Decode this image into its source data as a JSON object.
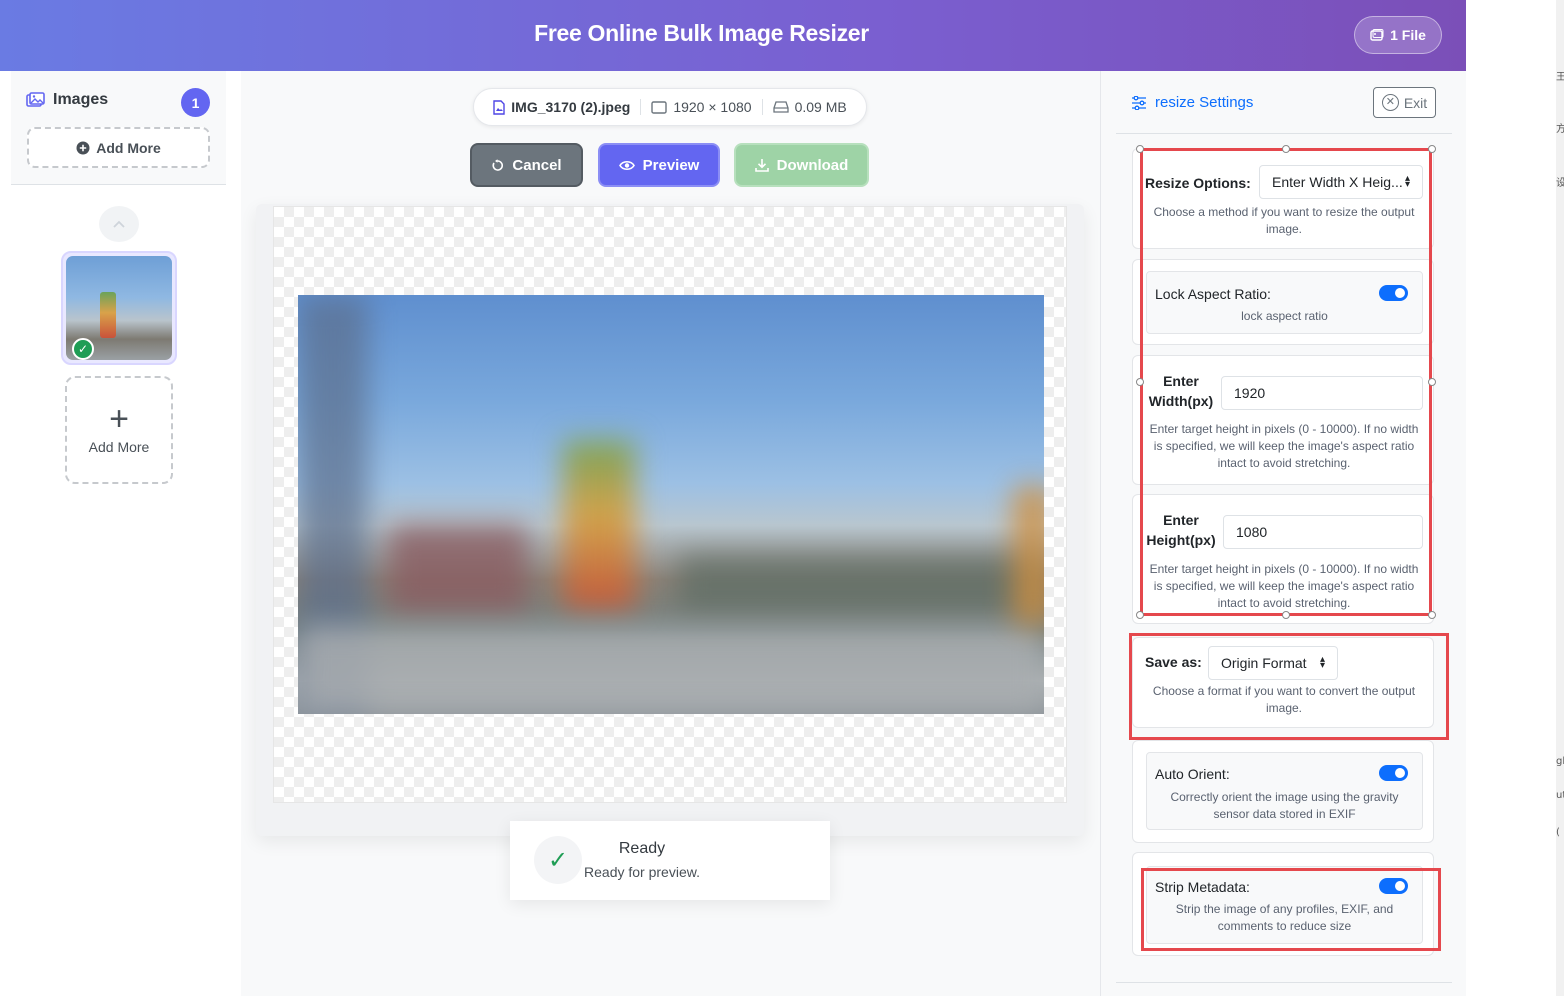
{
  "header": {
    "title": "Free Online Bulk Image Resizer",
    "file_count_label": "1 File"
  },
  "sidebar": {
    "title": "Images",
    "count": "1",
    "add_more_top": "Add More",
    "add_more_tile": "Add More"
  },
  "file_info": {
    "name": "IMG_3170 (2).jpeg",
    "dimensions": "1920 × 1080",
    "size": "0.09 MB"
  },
  "actions": {
    "cancel": "Cancel",
    "preview": "Preview",
    "download": "Download"
  },
  "status": {
    "title": "Ready",
    "subtitle": "Ready for preview."
  },
  "settings": {
    "title": "resize Settings",
    "exit": "Exit",
    "resize_options": {
      "label": "Resize Options:",
      "value": "Enter Width X Heig...",
      "help": "Choose a method if you want to resize the output image."
    },
    "lock_aspect": {
      "label": "Lock Aspect Ratio:",
      "help": "lock aspect ratio",
      "enabled": true
    },
    "width": {
      "label_line1": "Enter",
      "label_line2": "Width(px)",
      "value": "1920",
      "help": "Enter target height in pixels (0 - 10000). If no width is specified, we will keep the image's aspect ratio intact to avoid stretching."
    },
    "height": {
      "label_line1": "Enter",
      "label_line2": "Height(px)",
      "value": "1080",
      "help": "Enter target height in pixels (0 - 10000). If no width is specified, we will keep the image's aspect ratio intact to avoid stretching."
    },
    "save_as": {
      "label": "Save as:",
      "value": "Origin Format",
      "help": "Choose a format if you want to convert the output image."
    },
    "auto_orient": {
      "label": "Auto Orient:",
      "help": "Correctly orient the image using the gravity sensor data stored in EXIF",
      "enabled": true
    },
    "strip_metadata": {
      "label": "Strip Metadata:",
      "help": "Strip the image of any profiles, EXIF, and comments to reduce size",
      "enabled": true
    }
  },
  "colors": {
    "header_start": "#6a7be3",
    "header_end": "#7b4fb8",
    "primary": "#6366f1",
    "toggle_on": "#0d6efd",
    "success": "#1f9d55",
    "highlight": "#e5484d"
  },
  "edge_glyphs": [
    "王",
    "方",
    "设",
    "gl",
    "ut",
    "("
  ]
}
